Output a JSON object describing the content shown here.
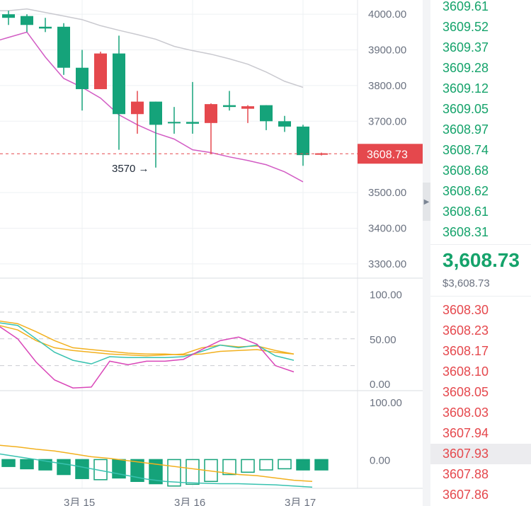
{
  "chart_data": {
    "type": "candlestick",
    "x_ticks": [
      "3月 15",
      "3月 16",
      "3月 17"
    ],
    "y_ticks": [
      "4000.00",
      "3900.00",
      "3800.00",
      "3700.00",
      "3500.00",
      "3400.00",
      "3300.00"
    ],
    "ylim": [
      3260,
      4040
    ],
    "candles": [
      {
        "o": 3990,
        "h": 4010,
        "l": 3970,
        "c": 4000
      },
      {
        "o": 3970,
        "h": 4000,
        "l": 3950,
        "c": 3995
      },
      {
        "o": 3960,
        "h": 3990,
        "l": 3950,
        "c": 3965
      },
      {
        "o": 3850,
        "h": 3975,
        "l": 3830,
        "c": 3965
      },
      {
        "o": 3790,
        "h": 3900,
        "l": 3730,
        "c": 3850
      },
      {
        "o": 3890,
        "h": 3895,
        "l": 3790,
        "c": 3790
      },
      {
        "o": 3720,
        "h": 3940,
        "l": 3620,
        "c": 3890
      },
      {
        "o": 3755,
        "h": 3785,
        "l": 3665,
        "c": 3720
      },
      {
        "o": 3690,
        "h": 3755,
        "l": 3570,
        "c": 3755
      },
      {
        "o": 3695,
        "h": 3740,
        "l": 3665,
        "c": 3698
      },
      {
        "o": 3693,
        "h": 3810,
        "l": 3665,
        "c": 3698
      },
      {
        "o": 3748,
        "h": 3750,
        "l": 3610,
        "c": 3695
      },
      {
        "o": 3740,
        "h": 3785,
        "l": 3730,
        "c": 3745
      },
      {
        "o": 3742,
        "h": 3745,
        "l": 3695,
        "c": 3735
      },
      {
        "o": 3700,
        "h": 3745,
        "l": 3675,
        "c": 3745
      },
      {
        "o": 3685,
        "h": 3715,
        "l": 3670,
        "c": 3700
      },
      {
        "o": 3605,
        "h": 3690,
        "l": 3575,
        "c": 3685
      },
      {
        "o": 3610,
        "h": 3612,
        "l": 3604,
        "c": 3608.73
      }
    ],
    "series": [
      {
        "name": "",
        "color": "#c9c9cf",
        "values": [
          4010,
          4010,
          4015,
          4005,
          3995,
          3985,
          3968,
          3955,
          3943,
          3930,
          3910,
          3898,
          3888,
          3875,
          3860,
          3838,
          3812,
          3795
        ]
      },
      {
        "name": "",
        "color": "#d25cc4",
        "values": [
          3920,
          3935,
          3950,
          3880,
          3820,
          3795,
          3765,
          3718,
          3690,
          3667,
          3650,
          3620,
          3612,
          3600,
          3590,
          3578,
          3558,
          3530
        ]
      }
    ],
    "annotations": [
      {
        "text": "3570",
        "candle": 8,
        "price": 3570,
        "side": "left"
      }
    ],
    "last_price": "3608.73",
    "last_price_value": 3608.73,
    "stoch": {
      "y_ticks": [
        "100.00",
        "50.00",
        "0.00"
      ],
      "ylim": [
        -8,
        118
      ],
      "dashed_levels": [
        80,
        50,
        20
      ],
      "k": [
        68,
        65,
        50,
        35,
        26,
        22,
        30,
        29,
        29,
        29,
        30,
        36,
        43,
        40,
        43,
        31,
        26
      ],
      "d": [
        65,
        60,
        48,
        40,
        37,
        35,
        33,
        32,
        31,
        32,
        33,
        40,
        43,
        41,
        42,
        37,
        33
      ],
      "slow": [
        70,
        67,
        58,
        48,
        40,
        38,
        36,
        34,
        33,
        33,
        32,
        33,
        36,
        37,
        38,
        35,
        33
      ],
      "j": [
        64,
        50,
        24,
        4,
        -5,
        -4,
        25,
        21,
        25,
        25,
        27,
        38,
        48,
        52,
        44,
        20,
        13
      ]
    },
    "macd": {
      "y_ticks": [
        "100.00",
        "0.00"
      ],
      "ylim": [
        -50,
        120
      ],
      "histogram": [
        -12,
        -16,
        -18,
        -26,
        -33,
        -35,
        -32,
        -38,
        -42,
        -46,
        -43,
        -38,
        -26,
        -22,
        -18,
        -16,
        -18,
        -18
      ],
      "histogram_hollow": [
        false,
        false,
        false,
        false,
        false,
        true,
        false,
        false,
        false,
        true,
        true,
        true,
        true,
        true,
        true,
        true,
        false,
        false
      ],
      "macd_line": [
        25,
        22,
        18,
        15,
        10,
        5,
        2,
        -2,
        -6,
        -10,
        -14,
        -18,
        -22,
        -26,
        -28,
        -32,
        -36,
        -38
      ],
      "signal_line": [
        10,
        5,
        0,
        -5,
        -10,
        -16,
        -22,
        -28,
        -34,
        -38,
        -40,
        -41,
        -42,
        -42,
        -43,
        -44,
        -46,
        -48
      ]
    }
  },
  "order_book": {
    "asks": [
      "3609.61",
      "3609.52",
      "3609.37",
      "3609.28",
      "3609.12",
      "3609.05",
      "3608.97",
      "3608.74",
      "3608.68",
      "3608.62",
      "3608.61",
      "3608.31"
    ],
    "mid_price": "3,608.73",
    "mid_usd": "$3,608.73",
    "bids": [
      "3608.30",
      "3608.23",
      "3608.17",
      "3608.10",
      "3608.05",
      "3608.03",
      "3607.94",
      "3607.93",
      "3607.88",
      "3607.86"
    ],
    "highlight_bid_index": 7
  },
  "colors": {
    "up": "#15a37a",
    "down": "#e5484d",
    "grid": "#eef0f3",
    "axis_text": "#6b7280"
  },
  "icons": {
    "collapse_handle": "chevron-right-icon"
  }
}
